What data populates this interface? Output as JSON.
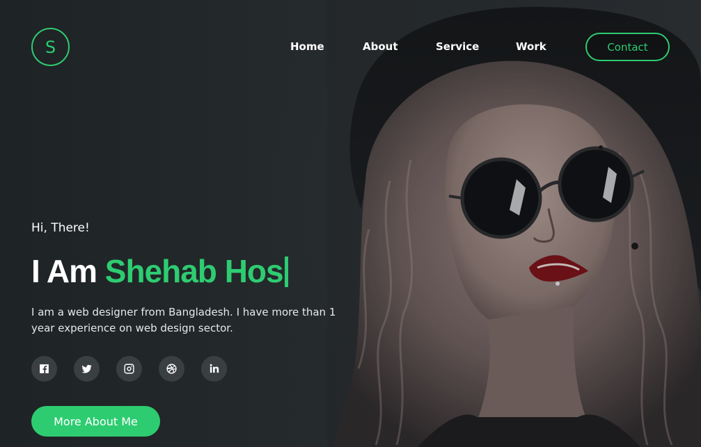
{
  "logo": {
    "letter": "S"
  },
  "nav": {
    "items": [
      {
        "label": "Home"
      },
      {
        "label": "About"
      },
      {
        "label": "Service"
      },
      {
        "label": "Work"
      }
    ],
    "contact_label": "Contact"
  },
  "hero": {
    "greeting": "Hi, There!",
    "headline_prefix": "I Am ",
    "headline_name": "Shehab Hos",
    "intro": "I am a web designer from Bangladesh. I have more than 1 year experience on web design sector.",
    "cta_label": "More About Me"
  },
  "social": [
    {
      "icon": "facebook-icon"
    },
    {
      "icon": "twitter-icon"
    },
    {
      "icon": "instagram-icon"
    },
    {
      "icon": "dribbble-icon"
    },
    {
      "icon": "linkedin-icon"
    }
  ],
  "colors": {
    "accent": "#2ecc71",
    "background": "#1f2426",
    "social_bg": "#3a3f41"
  }
}
